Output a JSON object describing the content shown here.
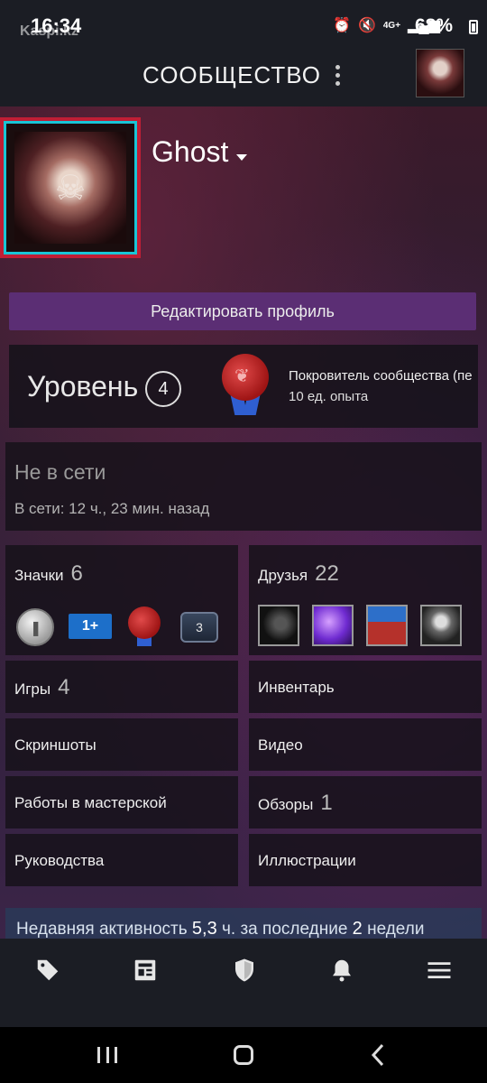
{
  "status_bar": {
    "time": "16:34",
    "watermark": "Kaspi.kz",
    "network": "4G+",
    "battery": "68%"
  },
  "header": {
    "title": "СООБЩЕСТВО"
  },
  "profile": {
    "name": "Ghost",
    "edit_label": "Редактировать профиль"
  },
  "level": {
    "label": "Уровень",
    "value": "4",
    "badge_name": "Покровитель сообщества (пе",
    "badge_xp": "10 ед. опыта"
  },
  "status": {
    "state": "Не в сети",
    "last_online": "В сети: 12 ч., 23 мин. назад"
  },
  "sections": {
    "badges": {
      "label": "Значки",
      "count": "6",
      "badge_2": "1+",
      "badge_4": "3"
    },
    "friends": {
      "label": "Друзья",
      "count": "22"
    },
    "games": {
      "label": "Игры",
      "count": "4"
    },
    "inventory": {
      "label": "Инвентарь"
    },
    "screenshots": {
      "label": "Скриншоты"
    },
    "videos": {
      "label": "Видео"
    },
    "workshop": {
      "label": "Работы в мастерской"
    },
    "reviews": {
      "label": "Обзоры",
      "count": "1"
    },
    "guides": {
      "label": "Руководства"
    },
    "artwork": {
      "label": "Иллюстрации"
    }
  },
  "activity": {
    "prefix": "Недавняя активность",
    "hours": "5,3",
    "middle": "ч. за последние",
    "weeks": "2",
    "suffix": "недели"
  },
  "tabbar": {
    "items": [
      "tag-icon",
      "news-icon",
      "shield-icon",
      "bell-icon",
      "menu-icon"
    ]
  },
  "colors": {
    "edit_button": "#5b2e74",
    "avatar_frame_red": "#c01e35",
    "avatar_frame_cyan": "#19c5d6",
    "bar_background": "#1b1d24"
  }
}
